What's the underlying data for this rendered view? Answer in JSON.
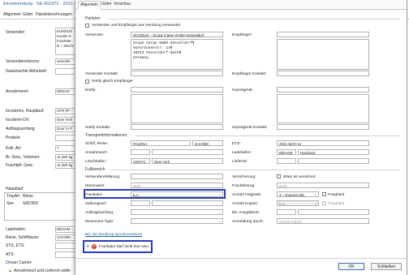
{
  "background": {
    "title": "Einzelsendung · SE-001972 · 2021-MAY-14",
    "tabs": [
      "Allgemein",
      "Güter",
      "Handelsrechnungen"
    ],
    "labels": [
      "Versender:",
      "Versenderreferenz:",
      "Gewünschte Abholzeit:",
      "Annahmeort:",
      "Incoterms, Hauptlauf:",
      "Incoterm-Ort:",
      "Auftragsumfang:",
      "Produkt:",
      "Kolli, Art:",
      "Br. Gew., Volumen:",
      "Frachtpfl. Gew.:",
      "Hauptlauf",
      "Ladehafen:",
      "Reise, Schiffskurs:",
      "STS, ETS:",
      "ATS:",
      "Ocean Carrier:"
    ],
    "values": [
      "KUNDUS",
      "Kunde G",
      "Frachtstr",
      "D – 40472",
      "verschie",
      "DEDUS",
      "CFR FP –",
      "New York",
      "Door to P",
      "7",
      "11.350 kg",
      "11.350 kg",
      "DEHAM –",
      "SAC959",
      "SAC959"
    ],
    "table_headers": [
      "TrspArt",
      "Reise"
    ],
    "table_row": [
      "See",
      "SAC959"
    ],
    "warning": "Annahmeort und Lieferort sollte"
  },
  "modal": {
    "tabs": [
      "Allgemein",
      "Güter",
      "Vorschau"
    ],
    "parteien_title": "Parteien",
    "versender_check_label": "Versender und Empfänger aus Sendung verwendet",
    "versender_label": "Versender:",
    "versender_name": "SCODUS – Scope Cargo GmbH Düsseldorf",
    "versender_address": [
      "Scope Cargo GmbH Düsseldorf¶",
      "Hunsrückenstr. 14¶",
      "40213 Düsseldorf-Nath¶",
      "Germany"
    ],
    "empfaenger_label": "Empfänger:",
    "versender_kontakt_label": "Versender Kontakt:",
    "empfaenger_kontakt_label": "Empfänger Kontakt:",
    "notify_check_label": "Notify gleich Empfänger",
    "notify_label": "Notify:",
    "importgeraet_label": "Importgerät:",
    "notify_kontakt_label": "Notify Kontakt:",
    "importgeraet_kontakt_label": "Importgerät Kontakt:",
    "transport_title": "Transportinformationen",
    "schiff_label": "Schiff, Reise:",
    "schiff_name": "PALENA",
    "schiff_reise": "SAC959",
    "ets_label": "ETS:",
    "ets_value": "2021-MAY-14",
    "annahmeort_label": "Annahmeort:",
    "ladehafen_label": "Ladehafen:",
    "ladehafen_code": "DEHAM",
    "ladehafen_name": "Hamburg",
    "loeschhafen_label": "Löschhafen:",
    "loeschhafen_code": "USNYC",
    "loeschhafen_name": "New York",
    "lieferort_label": "Lieferort:",
    "fuellbereich_title": "Fullbereich",
    "versenderklaerung_label": "Versendererklärung:",
    "versicherung_label": "Versicherung:",
    "ware_check_label": "Ware ist versichert",
    "warenwert_label": "Warenwert:",
    "warenwert_ph": "NVD",
    "frachtbetrag_label": "Frachtbetrag:",
    "frachtbetrag_ph": "NVD",
    "frankatur_label": "Frankatur:",
    "frankatur_value": "k.A.",
    "originale_label": "Anzahl Originale:",
    "originale_value": "3 – Express B/L",
    "freighted_label": "Freighted",
    "zahlungsort_label": "Zahlungsort:",
    "kopien_label": "Anzahl Kopien:",
    "kopien_value": "k.A.",
    "freighted2_label": "Freighted",
    "auftragsumfang_label": "Auftragsumfang:",
    "bl_ausgabe_label": "B/L Ausgabeort:",
    "movement_label": "Movement Type:",
    "anmeldung_label": "Anmeldung durch:",
    "anmeldung_ph": "Ocean Carrier",
    "sync_link": "B/L mit Sendung synchronisieren",
    "error_text": "Frankatur darf nicht leer sein.",
    "ok_label": "OK",
    "close_label": "Schließen"
  },
  "colors": {
    "highlight": "#2a3bbd",
    "error": "#d9342b",
    "link": "#1f5fa8"
  }
}
